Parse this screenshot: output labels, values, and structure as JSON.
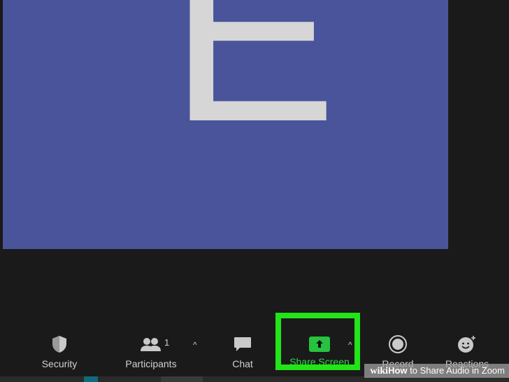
{
  "video": {
    "initial": "E",
    "tile_color": "#4a549b"
  },
  "toolbar": {
    "security_label": "Security",
    "participants_label": "Participants",
    "participants_count": "1",
    "chat_label": "Chat",
    "share_label": "Share Screen",
    "record_label": "Record",
    "reactions_label": "Reactions",
    "caret": "^"
  },
  "icons": {
    "security": "shield-icon",
    "participants": "participants-icon",
    "chat": "chat-bubble-icon",
    "share": "share-screen-arrow-icon",
    "record": "record-circle-icon",
    "reactions": "smiley-plus-icon"
  },
  "colors": {
    "background": "#1a1a1a",
    "highlight": "#22e418",
    "share_green": "#27c33f"
  },
  "watermark": {
    "wiki_prefix": "wiki",
    "bold": "How",
    "rest": " to Share Audio in Zoom"
  }
}
